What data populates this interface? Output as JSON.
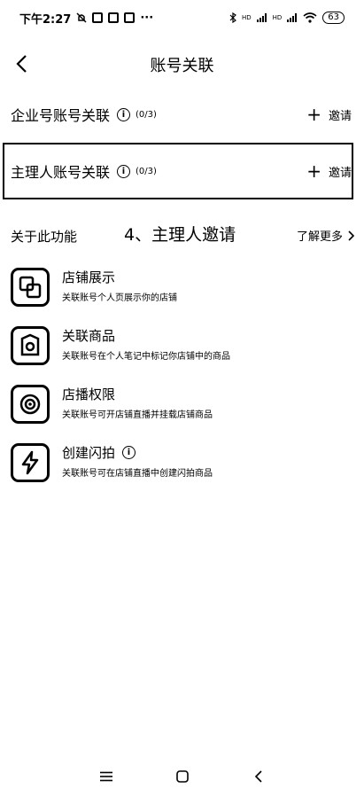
{
  "status_bar": {
    "time": "下午2:27",
    "signal1": "HD",
    "signal2": "HD",
    "battery": "63"
  },
  "nav": {
    "title": "账号关联"
  },
  "enterprise_row": {
    "title": "企业号账号关联",
    "count": "(0/3)",
    "invite_label": "邀请"
  },
  "owner_row": {
    "title": "主理人账号关联",
    "count": "(0/3)",
    "invite_label": "邀请"
  },
  "about": {
    "title": "关于此功能",
    "annotation": "4、主理人邀请",
    "learn_more": "了解更多"
  },
  "features": [
    {
      "name": "店铺展示",
      "desc": "关联账号个人页展示你的店铺",
      "icon": "store-display-icon"
    },
    {
      "name": "关联商品",
      "desc": "关联账号在个人笔记中标记你店铺中的商品",
      "icon": "linked-product-icon"
    },
    {
      "name": "店播权限",
      "desc": "关联账号可开店铺直播并挂载店铺商品",
      "icon": "store-live-icon"
    },
    {
      "name": "创建闪拍",
      "desc": "关联账号可在店铺直播中创建闪拍商品",
      "icon": "flash-sale-icon"
    }
  ]
}
